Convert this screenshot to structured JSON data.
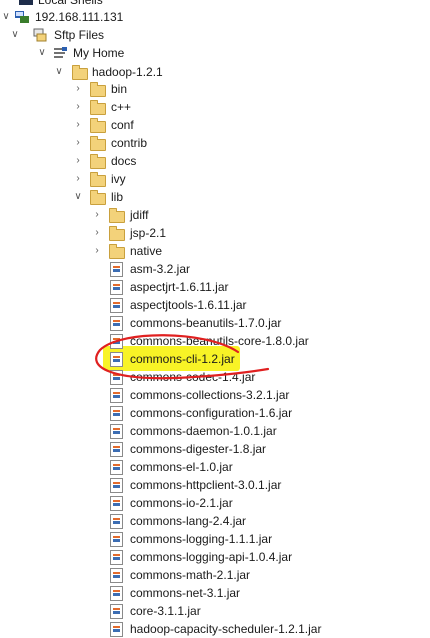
{
  "tree": {
    "top_partial": "Local Shells",
    "host": "192.168.111.131",
    "sftp": "Sftp Files",
    "home": "My Home",
    "project": "hadoop-1.2.1",
    "folders": [
      "bin",
      "c++",
      "conf",
      "contrib",
      "docs",
      "ivy"
    ],
    "lib": "lib",
    "lib_folders": [
      "jdiff",
      "jsp-2.1",
      "native"
    ],
    "jars": [
      "asm-3.2.jar",
      "aspectjrt-1.6.11.jar",
      "aspectjtools-1.6.11.jar",
      "commons-beanutils-1.7.0.jar",
      "commons-beanutils-core-1.8.0.jar",
      "commons-cli-1.2.jar",
      "commons-codec-1.4.jar",
      "commons-collections-3.2.1.jar",
      "commons-configuration-1.6.jar",
      "commons-daemon-1.0.1.jar",
      "commons-digester-1.8.jar",
      "commons-el-1.0.jar",
      "commons-httpclient-3.0.1.jar",
      "commons-io-2.1.jar",
      "commons-lang-2.4.jar",
      "commons-logging-1.1.1.jar",
      "commons-logging-api-1.0.4.jar",
      "commons-math-2.1.jar",
      "commons-net-3.1.jar",
      "core-3.1.1.jar",
      "hadoop-capacity-scheduler-1.2.1.jar"
    ]
  },
  "highlight": {
    "color": "#f7f100",
    "annotation_color": "#e02020"
  }
}
